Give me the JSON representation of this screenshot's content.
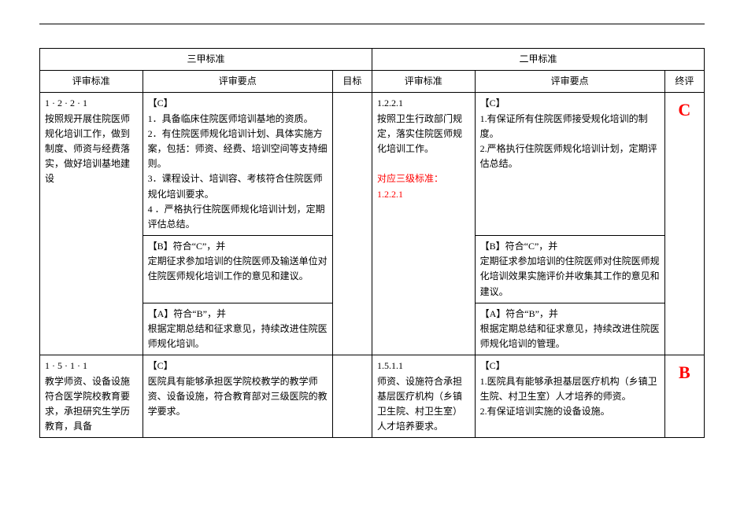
{
  "headers": {
    "groupA": "三甲标准",
    "groupB": "二甲标准",
    "stdA": "评审标准",
    "ptsA": "评审要点",
    "goal": "目标",
    "stdB": "评审标准",
    "ptsB": "评审要点",
    "final": "终评"
  },
  "row1": {
    "stdA_id": "1 · 2 · 2 · 1",
    "stdA_text": "按照规开展住院医师规化培训工作，做到制度、师资与经费落实，做好培训基地建设",
    "ptsA_c_label": "【C】",
    "ptsA_c_1": "1．具备临床住院医师培训基地的资质。",
    "ptsA_c_2": "2．有住院医师规化培训计划、具体实施方案，包括：师资、经费、培训空间等支持细则。",
    "ptsA_c_3": "3．课程设计、培训容、考核符合住院医师规化培训要求。",
    "ptsA_c_4": "4 ．严格执行住院医师规化培训计划，定期评估总结。",
    "ptsA_b_label": "【B】符合“C”，并",
    "ptsA_b_text": "定期征求参加培训的住院医师及输送单位对住院医师规化培训工作的意见和建议。",
    "ptsA_a_label": "【A】符合“B”，并",
    "ptsA_a_text": "根据定期总结和征求意见，持续改进住院医师规化培训。",
    "stdB_id": "1.2.2.1",
    "stdB_text": "按照卫生行政部门规定，落实住院医师规化培训工作。",
    "stdB_note_label": "对应三级标准：",
    "stdB_note_ref": "1.2.2.1",
    "ptsB_c_label": "【C】",
    "ptsB_c_1": "1.有保证所有住院医师接受规化培训的制度。",
    "ptsB_c_2": "2.严格执行住院医师规化培训计划，定期评估总结。",
    "ptsB_b_label": "【B】符合“C”，并",
    "ptsB_b_text": "定期征求参加培训的住院医师对住院医师规化培训效果实施评价并收集其工作的意见和建议。",
    "ptsB_a_label": "【A】符合“B”，并",
    "ptsB_a_text": "根据定期总结和征求意见，持续改进住院医师规化培训的管理。",
    "final_grade": "C"
  },
  "row2": {
    "stdA_id": "1 · 5 · 1 · 1",
    "stdA_text": "教学师资、设备设施符合医学院校教育要求，承担研究生学历教育，具备",
    "ptsA_c_label": "【C】",
    "ptsA_c_text": "医院具有能够承担医学院校教学的教学师资、设备设施，符合教育部对三级医院的教学要求。",
    "stdB_id": "1.5.1.1",
    "stdB_text": "师资、设施符合承担基层医疗机构（乡镇卫生院、村卫生室）人才培养要求。",
    "ptsB_c_label": "【C】",
    "ptsB_c_1": "1.医院具有能够承担基层医疗机构（乡镇卫生院、村卫生室）人才培养的师资。",
    "ptsB_c_2": "2.有保证培训实施的设备设施。",
    "final_grade": "B"
  }
}
